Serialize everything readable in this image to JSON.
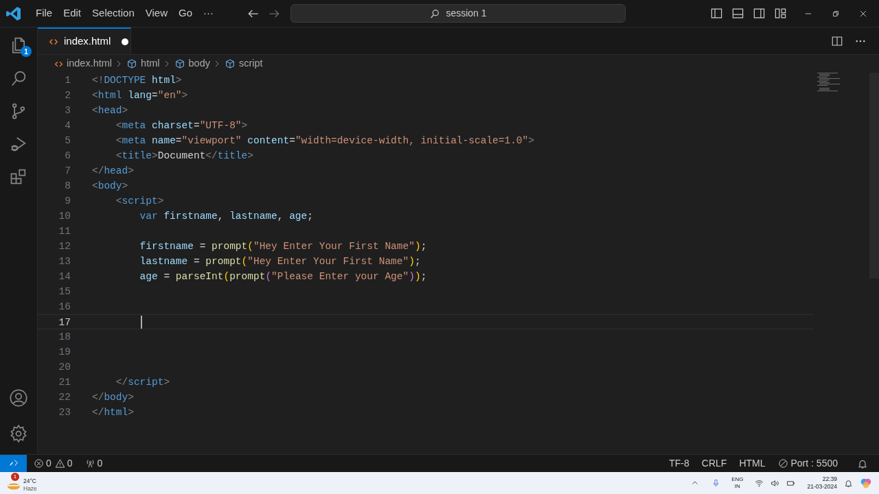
{
  "menu": [
    "File",
    "Edit",
    "Selection",
    "View",
    "Go",
    "···"
  ],
  "search": {
    "value": "session 1"
  },
  "activity": [
    {
      "kind": "files",
      "badge": "1"
    },
    {
      "kind": "search"
    },
    {
      "kind": "source"
    },
    {
      "kind": "debug"
    },
    {
      "kind": "extensions"
    }
  ],
  "tab": {
    "label": "index.html",
    "modified": true
  },
  "breadcrumb": [
    {
      "kind": "file",
      "label": "index.html"
    },
    {
      "kind": "symbol",
      "label": "html"
    },
    {
      "kind": "symbol",
      "label": "body"
    },
    {
      "kind": "symbol",
      "label": "script"
    }
  ],
  "lines": [
    {
      "number": "1",
      "current": false,
      "tokens": [
        {
          "kind": "bracket",
          "text": "<!"
        },
        {
          "kind": "tag",
          "text": "DOCTYPE"
        },
        {
          "kind": "attr",
          "text": " html"
        },
        {
          "kind": "bracket",
          "text": ">"
        }
      ]
    },
    {
      "number": "2",
      "current": false,
      "tokens": [
        {
          "kind": "bracket",
          "text": "<"
        },
        {
          "kind": "tag",
          "text": "html"
        },
        {
          "kind": "attr",
          "text": " lang"
        },
        {
          "kind": "text",
          "text": "="
        },
        {
          "kind": "string",
          "text": "\"en\""
        },
        {
          "kind": "bracket",
          "text": ">"
        }
      ]
    },
    {
      "number": "3",
      "current": false,
      "tokens": [
        {
          "kind": "bracket",
          "text": "<"
        },
        {
          "kind": "tag",
          "text": "head"
        },
        {
          "kind": "bracket",
          "text": ">"
        }
      ]
    },
    {
      "number": "4",
      "current": false,
      "tokens": [
        {
          "kind": "bracket",
          "text": "    <"
        },
        {
          "kind": "tag",
          "text": "meta"
        },
        {
          "kind": "attr",
          "text": " charset"
        },
        {
          "kind": "text",
          "text": "="
        },
        {
          "kind": "string",
          "text": "\"UTF-8\""
        },
        {
          "kind": "bracket",
          "text": ">"
        }
      ]
    },
    {
      "number": "5",
      "current": false,
      "tokens": [
        {
          "kind": "bracket",
          "text": "    <"
        },
        {
          "kind": "tag",
          "text": "meta"
        },
        {
          "kind": "attr",
          "text": " name"
        },
        {
          "kind": "text",
          "text": "="
        },
        {
          "kind": "string",
          "text": "\"viewport\""
        },
        {
          "kind": "attr",
          "text": " content"
        },
        {
          "kind": "text",
          "text": "="
        },
        {
          "kind": "string",
          "text": "\"width=device-width, initial-scale=1.0\""
        },
        {
          "kind": "bracket",
          "text": ">"
        }
      ]
    },
    {
      "number": "6",
      "current": false,
      "tokens": [
        {
          "kind": "bracket",
          "text": "    <"
        },
        {
          "kind": "tag",
          "text": "title"
        },
        {
          "kind": "bracket",
          "text": ">"
        },
        {
          "kind": "text",
          "text": "Document"
        },
        {
          "kind": "bracket",
          "text": "</"
        },
        {
          "kind": "tag",
          "text": "title"
        },
        {
          "kind": "bracket",
          "text": ">"
        }
      ]
    },
    {
      "number": "7",
      "current": false,
      "tokens": [
        {
          "kind": "bracket",
          "text": "</"
        },
        {
          "kind": "tag",
          "text": "head"
        },
        {
          "kind": "bracket",
          "text": ">"
        }
      ]
    },
    {
      "number": "8",
      "current": false,
      "tokens": [
        {
          "kind": "bracket",
          "text": "<"
        },
        {
          "kind": "tag",
          "text": "body"
        },
        {
          "kind": "bracket",
          "text": ">"
        }
      ]
    },
    {
      "number": "9",
      "current": false,
      "tokens": [
        {
          "kind": "bracket",
          "text": "    <"
        },
        {
          "kind": "tag",
          "text": "script"
        },
        {
          "kind": "bracket",
          "text": ">"
        }
      ]
    },
    {
      "number": "10",
      "current": false,
      "tokens": [
        {
          "kind": "keyword",
          "text": "        var"
        },
        {
          "kind": "variable",
          "text": " firstname"
        },
        {
          "kind": "text",
          "text": ", "
        },
        {
          "kind": "variable",
          "text": "lastname"
        },
        {
          "kind": "text",
          "text": ", "
        },
        {
          "kind": "variable",
          "text": "age"
        },
        {
          "kind": "text",
          "text": ";"
        }
      ]
    },
    {
      "number": "11",
      "current": false
    },
    {
      "number": "12",
      "current": false,
      "tokens": [
        {
          "kind": "variable",
          "text": "        firstname"
        },
        {
          "kind": "text",
          "text": " = "
        },
        {
          "kind": "function",
          "text": "prompt"
        },
        {
          "kind": "paren",
          "text": "("
        },
        {
          "kind": "string",
          "text": "\"Hey Enter Your First Name\""
        },
        {
          "kind": "paren",
          "text": ")"
        },
        {
          "kind": "text",
          "text": ";"
        }
      ]
    },
    {
      "number": "13",
      "current": false,
      "tokens": [
        {
          "kind": "variable",
          "text": "        lastname"
        },
        {
          "kind": "text",
          "text": " = "
        },
        {
          "kind": "function",
          "text": "prompt"
        },
        {
          "kind": "paren",
          "text": "("
        },
        {
          "kind": "string",
          "text": "\"Hey Enter Your First Name\""
        },
        {
          "kind": "paren",
          "text": ")"
        },
        {
          "kind": "text",
          "text": ";"
        }
      ]
    },
    {
      "number": "14",
      "current": false,
      "tokens": [
        {
          "kind": "variable",
          "text": "        age"
        },
        {
          "kind": "text",
          "text": " = "
        },
        {
          "kind": "function",
          "text": "parseInt"
        },
        {
          "kind": "paren",
          "text": "("
        },
        {
          "kind": "function",
          "text": "prompt"
        },
        {
          "kind": "paren2",
          "text": "("
        },
        {
          "kind": "string",
          "text": "\"Please Enter your Age\""
        },
        {
          "kind": "paren2",
          "text": ")"
        },
        {
          "kind": "paren",
          "text": ")"
        },
        {
          "kind": "text",
          "text": ";"
        }
      ]
    },
    {
      "number": "15",
      "current": false
    },
    {
      "number": "16",
      "current": false
    },
    {
      "number": "17",
      "current": true
    },
    {
      "number": "18",
      "current": false
    },
    {
      "number": "19",
      "current": false
    },
    {
      "number": "20",
      "current": false
    },
    {
      "number": "21",
      "current": false,
      "tokens": [
        {
          "kind": "bracket",
          "text": "    </"
        },
        {
          "kind": "tag",
          "text": "script"
        },
        {
          "kind": "bracket",
          "text": ">"
        }
      ]
    },
    {
      "number": "22",
      "current": false,
      "tokens": [
        {
          "kind": "bracket",
          "text": "</"
        },
        {
          "kind": "tag",
          "text": "body"
        },
        {
          "kind": "bracket",
          "text": ">"
        }
      ]
    },
    {
      "number": "23",
      "current": false,
      "tokens": [
        {
          "kind": "bracket",
          "text": "</"
        },
        {
          "kind": "tag",
          "text": "html"
        },
        {
          "kind": "bracket",
          "text": ">"
        }
      ]
    }
  ],
  "status": {
    "errors": "0",
    "warnings": "0",
    "ports": "0",
    "right": [
      "TF-8",
      "CRLF",
      "HTML"
    ],
    "port": "Port : 5500"
  },
  "taskbar": {
    "weather": {
      "temp": "24°C",
      "text": "Haze",
      "badge": "1"
    },
    "lang": [
      "ENG",
      "IN"
    ],
    "time": "22:39",
    "date": "21-03-2024"
  }
}
